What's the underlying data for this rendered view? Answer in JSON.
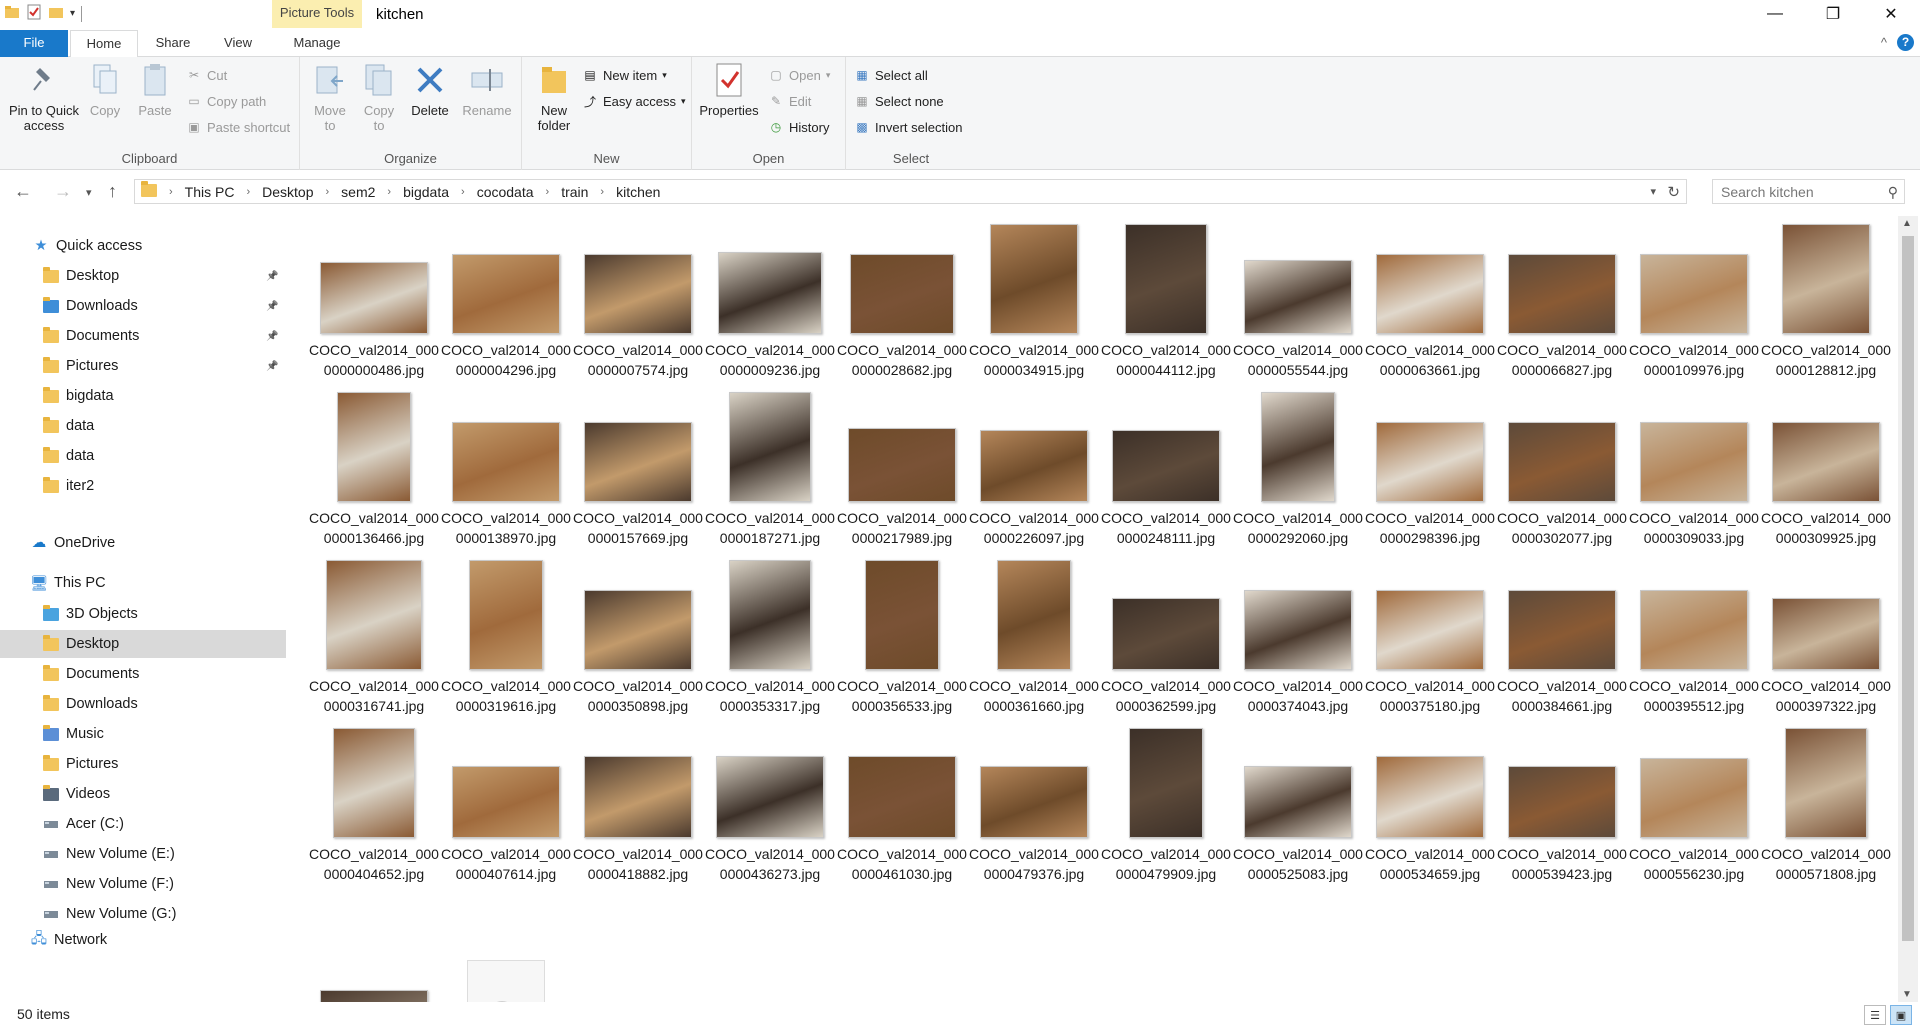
{
  "titlebar": {
    "context_tab": "Picture Tools",
    "title": "kitchen",
    "minimize": "—",
    "restore": "❐",
    "close": "✕"
  },
  "tabs": {
    "file": "File",
    "home": "Home",
    "share": "Share",
    "view": "View",
    "manage": "Manage",
    "collapse_icon": "^",
    "help": "?"
  },
  "ribbon": {
    "clipboard": {
      "label": "Clipboard",
      "pin": "Pin to Quick access",
      "copy": "Copy",
      "paste": "Paste",
      "cut": "Cut",
      "copy_path": "Copy path",
      "paste_shortcut": "Paste shortcut"
    },
    "organize": {
      "label": "Organize",
      "move_to": "Move to",
      "copy_to": "Copy to",
      "delete": "Delete",
      "rename": "Rename"
    },
    "new": {
      "label": "New",
      "new_folder": "New folder",
      "new_item": "New item",
      "easy_access": "Easy access"
    },
    "open": {
      "label": "Open",
      "properties": "Properties",
      "open": "Open",
      "edit": "Edit",
      "history": "History"
    },
    "select": {
      "label": "Select",
      "select_all": "Select all",
      "select_none": "Select none",
      "invert": "Invert selection"
    }
  },
  "address": {
    "crumbs": [
      "This PC",
      "Desktop",
      "sem2",
      "bigdata",
      "cocodata",
      "train",
      "kitchen"
    ],
    "search_placeholder": "Search kitchen"
  },
  "nav": {
    "quick_access": "Quick access",
    "quick_items": [
      "Desktop",
      "Downloads",
      "Documents",
      "Pictures",
      "bigdata",
      "data",
      "data",
      "iter2"
    ],
    "onedrive": "OneDrive",
    "this_pc": "This PC",
    "pc_items": [
      "3D Objects",
      "Desktop",
      "Documents",
      "Downloads",
      "Music",
      "Pictures",
      "Videos",
      "Acer (C:)",
      "New Volume (E:)",
      "New Volume (F:)",
      "New Volume (G:)"
    ],
    "network": "Network"
  },
  "files": [
    "000000000486",
    "000000004296",
    "000000007574",
    "000000009236",
    "000000028682",
    "000000034915",
    "000000044112",
    "000000055544",
    "000000063661",
    "000000066827",
    "000000109976",
    "000000128812",
    "000000136466",
    "000000138970",
    "000000157669",
    "000000187271",
    "000000217989",
    "000000226097",
    "000000248111",
    "000000292060",
    "000000298396",
    "000000302077",
    "000000309033",
    "000000309925",
    "000000316741",
    "000000319616",
    "000000350898",
    "000000353317",
    "000000356533",
    "000000361660",
    "000000362599",
    "000000374043",
    "000000375180",
    "000000384661",
    "000000395512",
    "000000397322",
    "000000404652",
    "000000407614",
    "000000418882",
    "000000436273",
    "000000461030",
    "000000479376",
    "000000479909",
    "000000525083",
    "000000534659",
    "000000539423",
    "000000556230",
    "000000571808"
  ],
  "file_prefix": "COCO_val2014_0",
  "file_ext": ".jpg",
  "status": {
    "count": "50 items"
  }
}
